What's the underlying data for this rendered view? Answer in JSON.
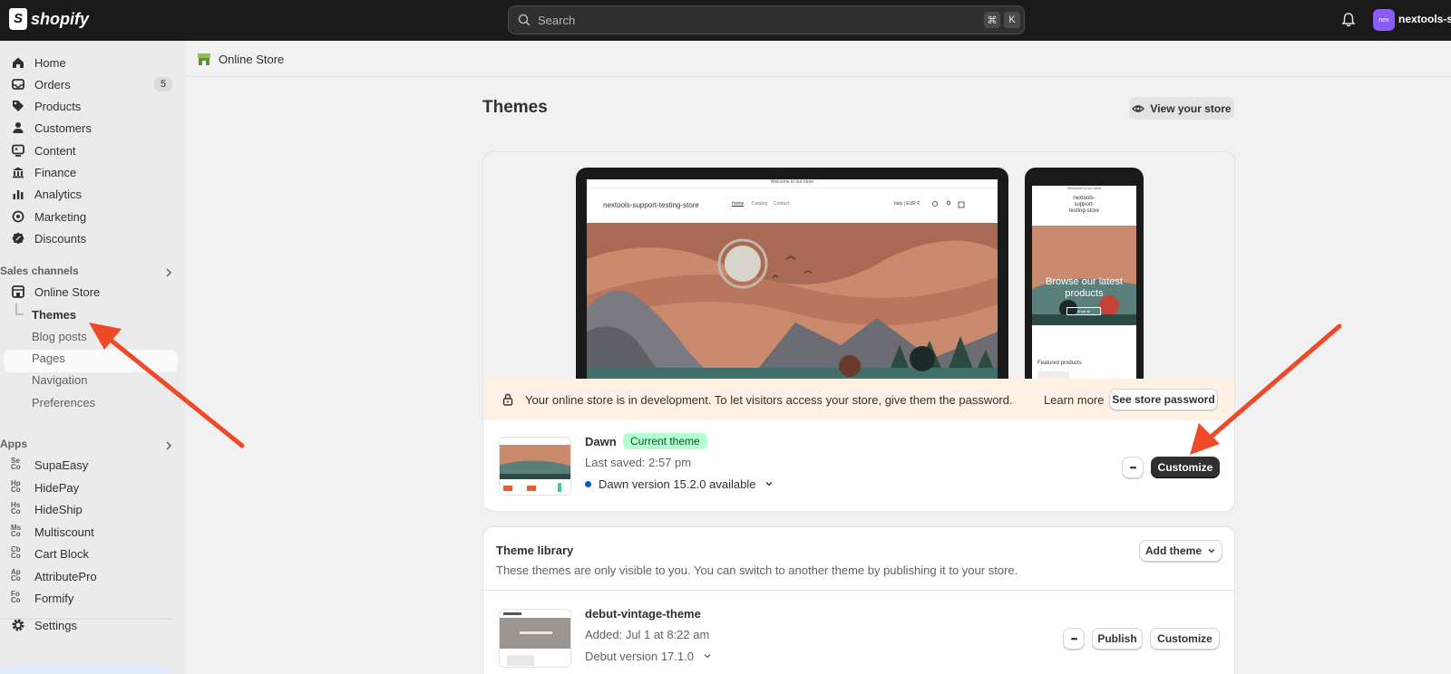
{
  "topbar": {
    "brand": "shopify",
    "search_placeholder": "Search",
    "shortcut_cmd": "⌘",
    "shortcut_key": "K",
    "store_avatar": "nex",
    "store_name": "nextools-su"
  },
  "sidebar": {
    "items": [
      {
        "label": "Home"
      },
      {
        "label": "Orders",
        "badge": "5"
      },
      {
        "label": "Products"
      },
      {
        "label": "Customers"
      },
      {
        "label": "Content"
      },
      {
        "label": "Finance"
      },
      {
        "label": "Analytics"
      },
      {
        "label": "Marketing"
      },
      {
        "label": "Discounts"
      }
    ],
    "sales_channels_title": "Sales channels",
    "online_store": "Online Store",
    "online_store_sub": [
      "Themes",
      "Blog posts",
      "Pages",
      "Navigation",
      "Preferences"
    ],
    "apps_title": "Apps",
    "apps": [
      {
        "label": "SupaEasy",
        "abbr": [
          "Se",
          "Co"
        ]
      },
      {
        "label": "HidePay",
        "abbr": [
          "Hp",
          "Co"
        ]
      },
      {
        "label": "HideShip",
        "abbr": [
          "Hs",
          "Co"
        ]
      },
      {
        "label": "Multiscount",
        "abbr": [
          "Ms",
          "Co"
        ]
      },
      {
        "label": "Cart Block",
        "abbr": [
          "Cb",
          "Co"
        ]
      },
      {
        "label": "AttributePro",
        "abbr": [
          "Ap",
          "Co"
        ]
      },
      {
        "label": "Formify",
        "abbr": [
          "Fo",
          "Co"
        ]
      }
    ],
    "settings": "Settings"
  },
  "header": {
    "label": "Online Store"
  },
  "main": {
    "title": "Themes",
    "view_store": "View your store",
    "preview": {
      "announcement": "Welcome to our store",
      "store_title": "nextools-support-testing-store",
      "nav_links": [
        "Home",
        "Catalog",
        "Contact"
      ],
      "locale": "Italy | EUR €",
      "phone_store_title": "nextools-\nsupport-\ntesting-store",
      "phone_hero": "Browse our latest products",
      "phone_shop_all": "Shop all",
      "phone_featured": "Featured products"
    },
    "dev_banner": {
      "text": "Your online store is in development. To let visitors access your store, give them the password.",
      "learn_more": "Learn more",
      "button": "See store password"
    },
    "current_theme": {
      "name": "Dawn",
      "badge": "Current theme",
      "last_saved": "Last saved: 2:57 pm",
      "version": "Dawn version 15.2.0 available",
      "more": "•••",
      "customize": "Customize"
    },
    "library": {
      "title": "Theme library",
      "description": "These themes are only visible to you. You can switch to another theme by publishing it to your store.",
      "add_theme": "Add theme",
      "themes": [
        {
          "name": "debut-vintage-theme",
          "added": "Added: Jul 1 at 8:22 am",
          "version": "Debut version 17.1.0",
          "more": "•••",
          "publish": "Publish",
          "customize": "Customize"
        }
      ]
    }
  },
  "colors": {
    "topbar": "#1a1a1a",
    "accent_arrow": "#ee4a2a",
    "badge_green": "#b4fed2",
    "dev_banner": "#fff1e3"
  }
}
